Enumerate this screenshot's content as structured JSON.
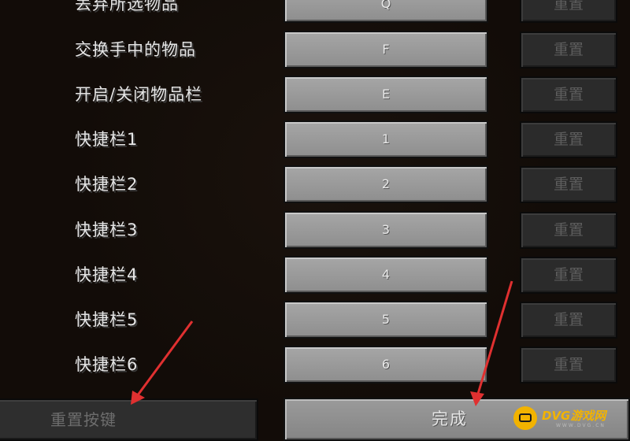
{
  "keybindings": [
    {
      "label": "丢弃所选物品",
      "key": "Q",
      "reset": "重置"
    },
    {
      "label": "交换手中的物品",
      "key": "F",
      "reset": "重置"
    },
    {
      "label": "开启/关闭物品栏",
      "key": "E",
      "reset": "重置"
    },
    {
      "label": "快捷栏1",
      "key": "1",
      "reset": "重置"
    },
    {
      "label": "快捷栏2",
      "key": "2",
      "reset": "重置"
    },
    {
      "label": "快捷栏3",
      "key": "3",
      "reset": "重置"
    },
    {
      "label": "快捷栏4",
      "key": "4",
      "reset": "重置"
    },
    {
      "label": "快捷栏5",
      "key": "5",
      "reset": "重置"
    },
    {
      "label": "快捷栏6",
      "key": "6",
      "reset": "重置"
    }
  ],
  "footer": {
    "reset_keys_label": "重置按键",
    "done_label": "完成"
  },
  "watermark": {
    "title": "DVG游戏网",
    "url": "WWW.DVG.CN"
  },
  "colors": {
    "arrow": "#e03030",
    "watermark_accent": "#f2b300"
  }
}
